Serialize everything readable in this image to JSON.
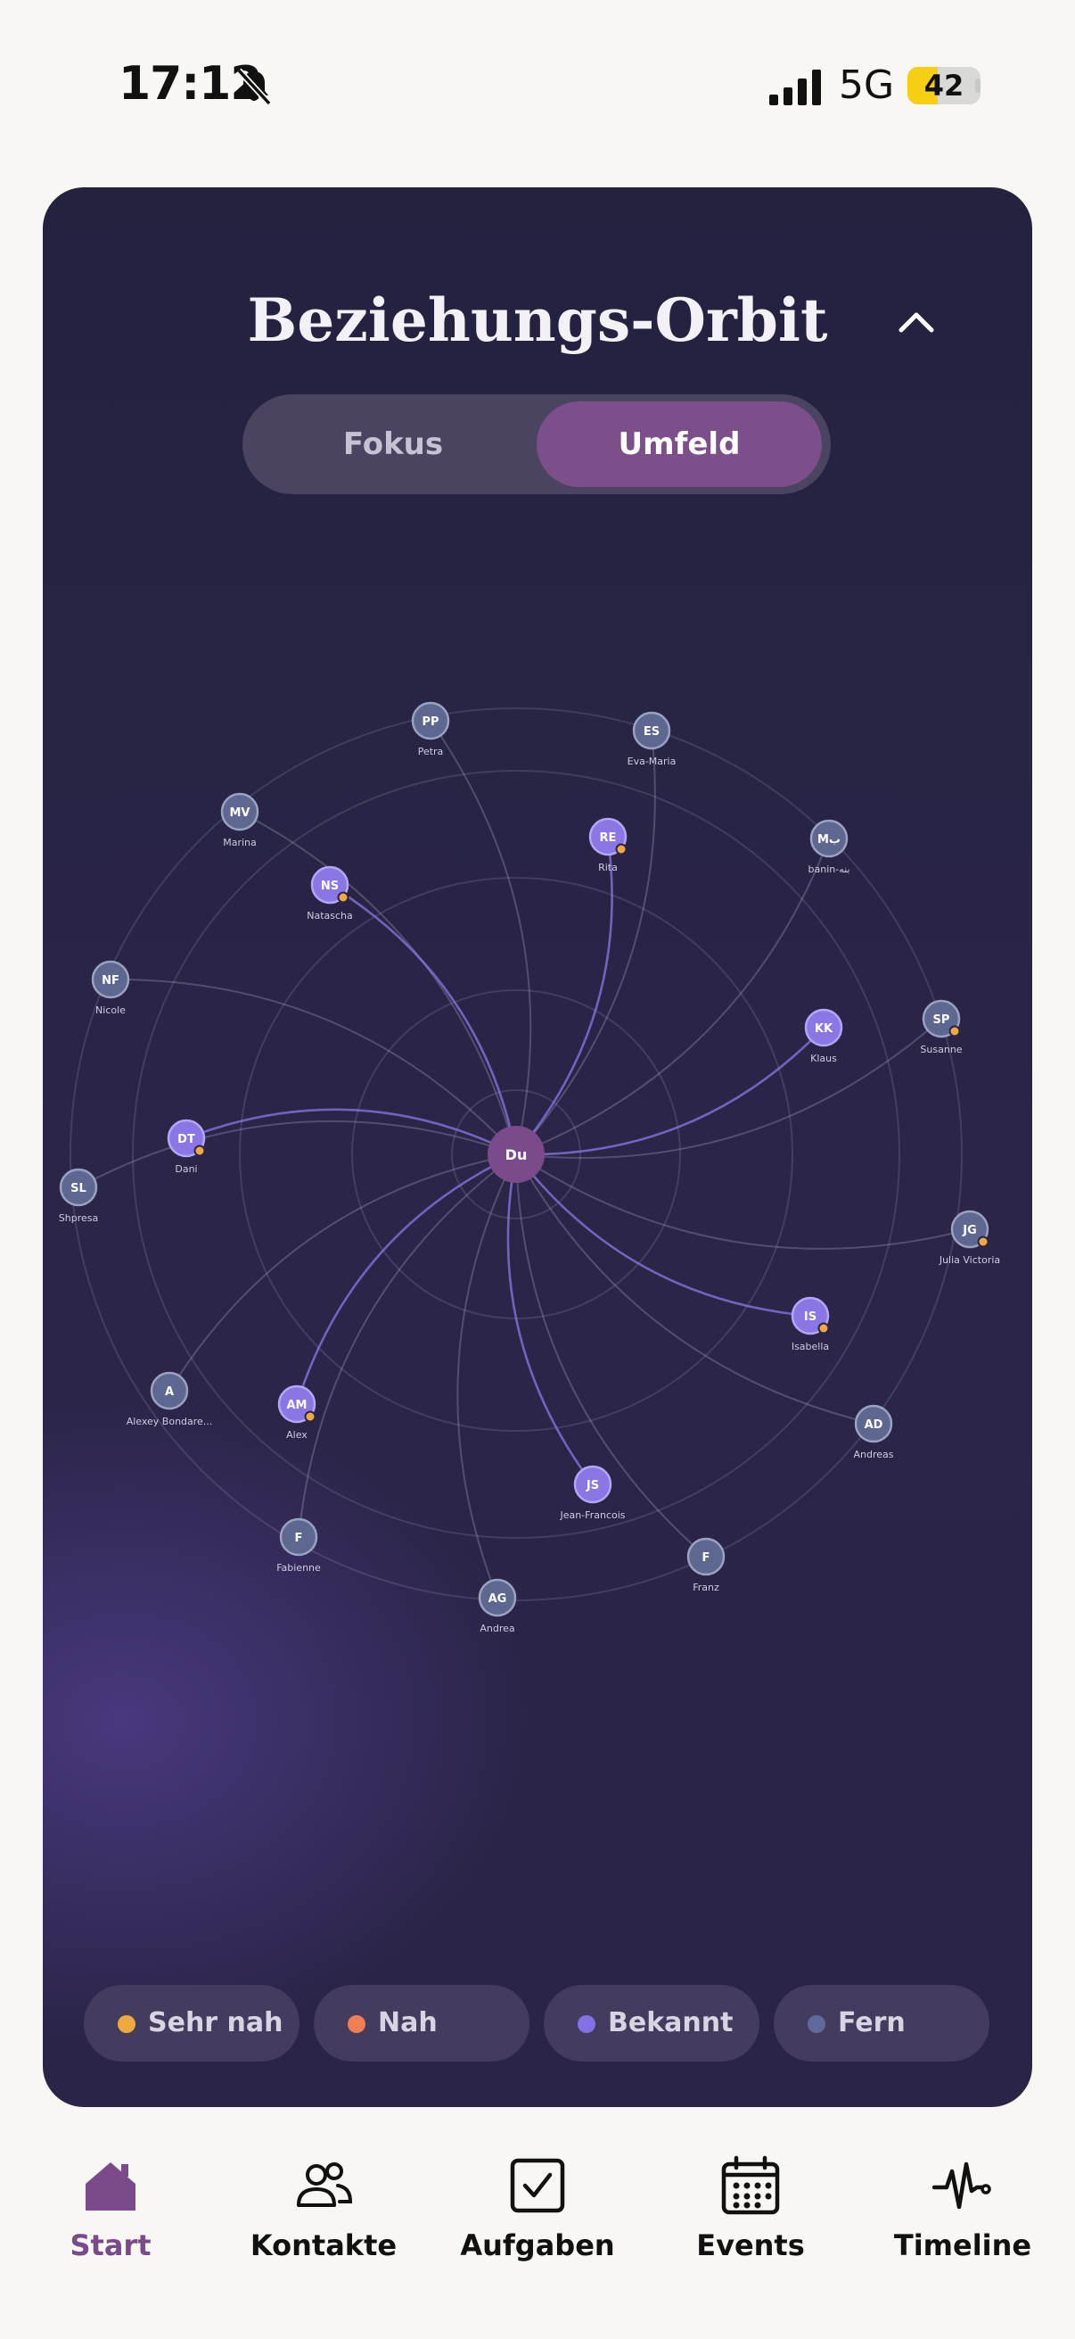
{
  "status_bar": {
    "time": "17:12",
    "network": "5G",
    "battery": "42",
    "battery_level": 0.42
  },
  "card": {
    "title": "Beziehungs-Orbit",
    "segments": [
      {
        "label": "Fokus",
        "active": false
      },
      {
        "label": "Umfeld",
        "active": true
      }
    ]
  },
  "orbit": {
    "center_label": "Du",
    "contacts": [
      {
        "initials": "PP",
        "name": "Petra",
        "level": "fern"
      },
      {
        "initials": "ES",
        "name": "Eva-Maria",
        "level": "fern"
      },
      {
        "initials": "MV",
        "name": "Marina",
        "level": "fern"
      },
      {
        "initials": "RE",
        "name": "Rita",
        "level": "bekannt",
        "flag": true
      },
      {
        "initials": "Mب",
        "name": "banin-بنه",
        "level": "fern"
      },
      {
        "initials": "NS",
        "name": "Natascha",
        "level": "bekannt",
        "flag": true
      },
      {
        "initials": "NF",
        "name": "Nicole",
        "level": "fern"
      },
      {
        "initials": "KK",
        "name": "Klaus",
        "level": "bekannt"
      },
      {
        "initials": "SP",
        "name": "Susanne",
        "level": "fern",
        "flag": true
      },
      {
        "initials": "DT",
        "name": "Dani",
        "level": "bekannt",
        "flag": true
      },
      {
        "initials": "SL",
        "name": "Shpresa",
        "level": "fern"
      },
      {
        "initials": "JG",
        "name": "Julia Victoria",
        "level": "fern",
        "flag": true
      },
      {
        "initials": "IS",
        "name": "Isabella",
        "level": "bekannt",
        "flag": true
      },
      {
        "initials": "A",
        "name": "Alexey Bondare...",
        "level": "fern"
      },
      {
        "initials": "AM",
        "name": "Alex",
        "level": "bekannt",
        "flag": true
      },
      {
        "initials": "AD",
        "name": "Andreas",
        "level": "fern"
      },
      {
        "initials": "JS",
        "name": "Jean-Francois",
        "level": "bekannt"
      },
      {
        "initials": "F",
        "name": "Fabienne",
        "level": "fern"
      },
      {
        "initials": "F",
        "name": "Franz",
        "level": "fern"
      },
      {
        "initials": "AG",
        "name": "Andrea",
        "level": "fern"
      }
    ]
  },
  "legend": [
    {
      "label": "Sehr nah",
      "color": "#f0a93c"
    },
    {
      "label": "Nah",
      "color": "#ef7f52"
    },
    {
      "label": "Bekannt",
      "color": "#8471e6"
    },
    {
      "label": "Fern",
      "color": "#5f6a9a"
    }
  ],
  "tabbar": [
    {
      "label": "Start",
      "icon": "home-icon",
      "active": true
    },
    {
      "label": "Kontakte",
      "icon": "people-icon",
      "active": false
    },
    {
      "label": "Aufgaben",
      "icon": "checkbox-icon",
      "active": false
    },
    {
      "label": "Events",
      "icon": "calendar-icon",
      "active": false
    },
    {
      "label": "Timeline",
      "icon": "pulse-icon",
      "active": false
    }
  ],
  "colors": {
    "accent": "#7b4a8a",
    "bekannt_node": "#8b76e6",
    "fern_node": "#5d6790",
    "flag": "#f0a93c"
  }
}
